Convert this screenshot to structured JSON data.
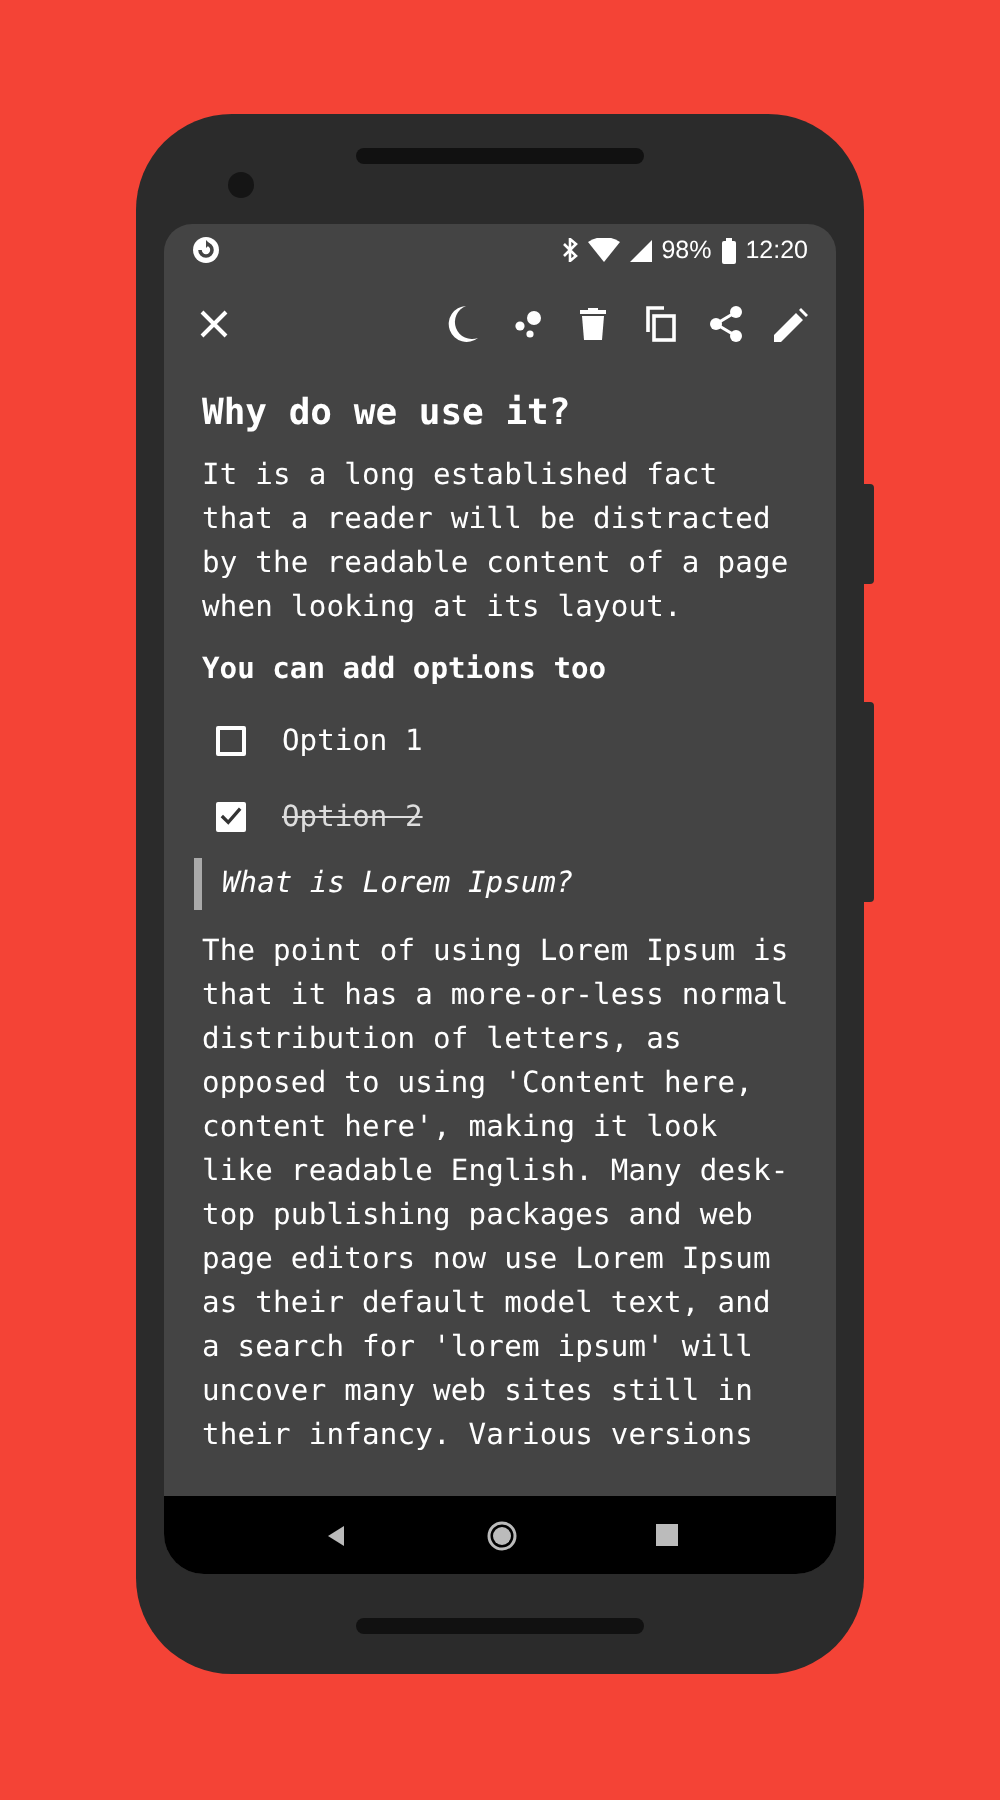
{
  "status_bar": {
    "battery": "98%",
    "time": "12:20"
  },
  "note": {
    "title": "Why do we use it?",
    "intro": "It is a long established fact\nthat a reader will be distracted\nby the readable content of a page\nwhen looking at its layout.",
    "subheading": "You can add options too",
    "checklist": [
      {
        "label": "Option 1",
        "checked": false
      },
      {
        "label": "Option 2",
        "checked": true
      }
    ],
    "quote": "What is Lorem Ipsum?",
    "body": "The point of using Lorem Ipsum is\nthat it has a more-or-less normal\ndistribution of letters, as\nopposed to using 'Content here,\ncontent here', making it look\nlike readable English. Many desk-\ntop publishing packages and web\npage editors now use Lorem Ipsum\nas their default model text, and\na search for 'lorem ipsum' will\nuncover many web sites still in\ntheir infancy. Various versions"
  }
}
